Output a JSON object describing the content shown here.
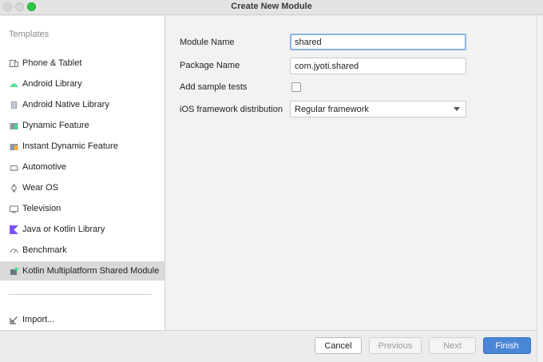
{
  "window": {
    "title": "Create New Module"
  },
  "sidebar": {
    "header": "Templates",
    "items": [
      {
        "label": "Phone & Tablet",
        "icon": "phone-tablet-icon"
      },
      {
        "label": "Android Library",
        "icon": "android-icon"
      },
      {
        "label": "Android Native Library",
        "icon": "native-library-icon"
      },
      {
        "label": "Dynamic Feature",
        "icon": "dynamic-feature-icon"
      },
      {
        "label": "Instant Dynamic Feature",
        "icon": "instant-dynamic-feature-icon"
      },
      {
        "label": "Automotive",
        "icon": "car-icon"
      },
      {
        "label": "Wear OS",
        "icon": "watch-icon"
      },
      {
        "label": "Television",
        "icon": "tv-icon"
      },
      {
        "label": "Java or Kotlin Library",
        "icon": "kotlin-icon"
      },
      {
        "label": "Benchmark",
        "icon": "gauge-icon"
      },
      {
        "label": "Kotlin Multiplatform Shared Module",
        "icon": "multiplatform-icon",
        "selected": true
      }
    ],
    "import_label": "Import..."
  },
  "form": {
    "module_name_label": "Module Name",
    "module_name_value": "shared",
    "package_name_label": "Package Name",
    "package_name_value": "com.jyoti.shared",
    "add_sample_tests_label": "Add sample tests",
    "add_sample_tests_checked": false,
    "ios_distribution_label": "iOS framework distribution",
    "ios_distribution_value": "Regular framework"
  },
  "buttons": {
    "cancel": "Cancel",
    "previous": "Previous",
    "next": "Next",
    "finish": "Finish"
  },
  "colors": {
    "accent": "#4a86d6",
    "selection": "#d9d9d9",
    "android_green": "#3ddc84",
    "kotlin_purple": "#7f52ff"
  }
}
